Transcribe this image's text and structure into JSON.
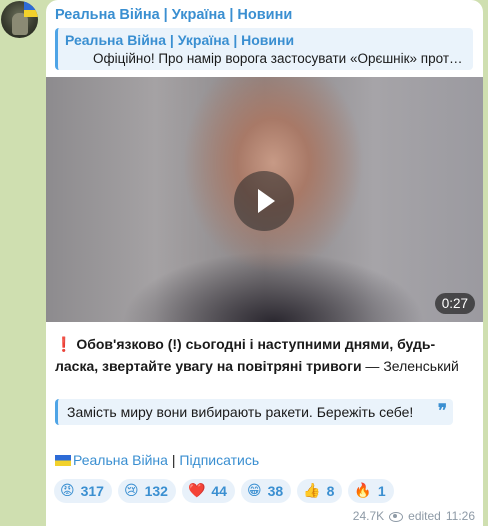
{
  "channel": {
    "name": "Реальна Війна | Україна | Новини"
  },
  "forward": {
    "source": "Реальна Війна | Україна | Новини",
    "snippet": "Офіційно! Про намір ворога застосувати «Орєшнік» проти…"
  },
  "video": {
    "duration": "0:27"
  },
  "caption": {
    "exclamation": "❗",
    "bold_text": "Обов'язково (!) сьогодні і наступними днями, будь-ласка, звертайте увагу на повітряні тривоги",
    "suffix": " — Зеленський"
  },
  "quote": {
    "text": "Замість миру вони вибирають ракети. Бережіть себе!",
    "mark": "❞"
  },
  "links": {
    "channel_link": "Реальна Війна",
    "separator": " | ",
    "subscribe_link": "Підписатись"
  },
  "reactions": [
    {
      "emoji": "😡",
      "count": "317"
    },
    {
      "emoji": "😢",
      "count": "132"
    },
    {
      "emoji": "❤️",
      "count": "44"
    },
    {
      "emoji": "😁",
      "count": "38"
    },
    {
      "emoji": "👍",
      "count": "8"
    },
    {
      "emoji": "🔥",
      "count": "1"
    }
  ],
  "meta": {
    "views": "24.7K",
    "edited": "edited",
    "time": "11:26"
  },
  "colors": {
    "accent": "#3a8fd1",
    "chat_bg": "#cfdfb0"
  }
}
